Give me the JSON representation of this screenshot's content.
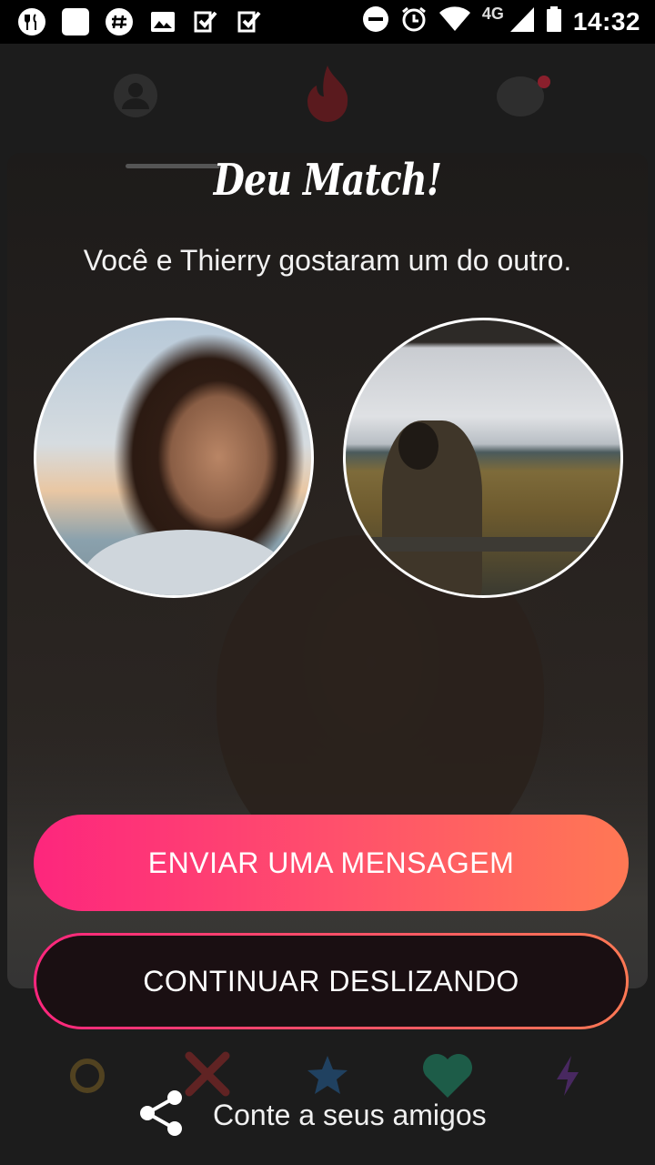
{
  "status_bar": {
    "network": "4G",
    "time": "14:32",
    "icons": [
      "fork-knife-icon",
      "blank-icon",
      "slack-icon",
      "image-icon",
      "check-square-icon",
      "check-square-icon",
      "dnd-icon",
      "alarm-icon",
      "wifi-icon",
      "signal-icon",
      "battery-icon"
    ]
  },
  "nav": {
    "icons": [
      "profile-icon",
      "flame-icon",
      "messages-icon"
    ]
  },
  "modal": {
    "title": "Deu Match!",
    "subtitle": "Você e Thierry gostaram um do outro.",
    "primary_button": "ENVIAR UMA MENSAGEM",
    "secondary_button": "CONTINUAR DESLIZANDO",
    "share_label": "Conte a seus amigos"
  },
  "colors": {
    "gradient_start": "#fd267d",
    "gradient_end": "#ff7854",
    "status_bar": "#000000",
    "background": "#1b1b1b"
  }
}
